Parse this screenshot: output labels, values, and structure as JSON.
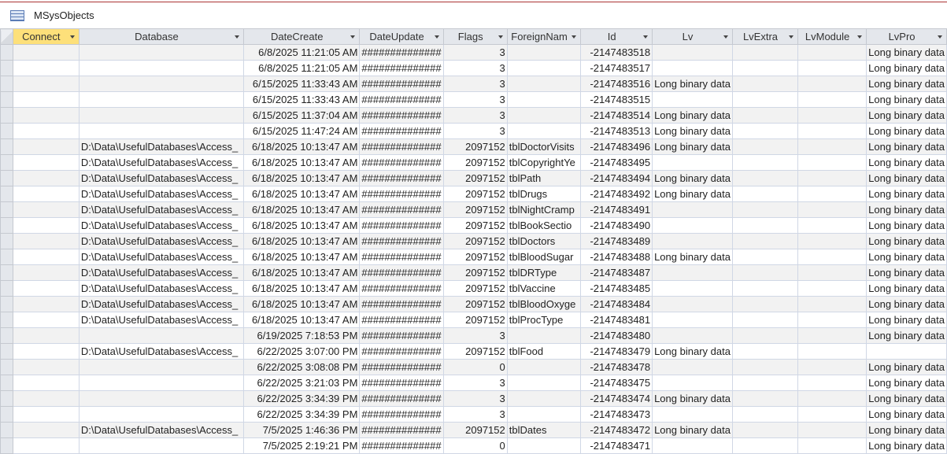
{
  "window": {
    "title": "MSysObjects",
    "icon": "table-icon"
  },
  "columns": [
    "Connect",
    "Database",
    "DateCreate",
    "DateUpdate",
    "Flags",
    "ForeignNam",
    "Id",
    "Lv",
    "LvExtra",
    "LvModule",
    "LvPro"
  ],
  "rows": [
    [
      "",
      "",
      "6/8/2025 11:21:05 AM",
      "##############",
      "3",
      "",
      "-2147483518",
      "",
      "",
      "",
      "Long binary data"
    ],
    [
      "",
      "",
      "6/8/2025 11:21:05 AM",
      "##############",
      "3",
      "",
      "-2147483517",
      "",
      "",
      "",
      "Long binary data"
    ],
    [
      "",
      "",
      "6/15/2025 11:33:43 AM",
      "##############",
      "3",
      "",
      "-2147483516",
      "Long binary data",
      "",
      "",
      "Long binary data"
    ],
    [
      "",
      "",
      "6/15/2025 11:33:43 AM",
      "##############",
      "3",
      "",
      "-2147483515",
      "",
      "",
      "",
      "Long binary data"
    ],
    [
      "",
      "",
      "6/15/2025 11:37:04 AM",
      "##############",
      "3",
      "",
      "-2147483514",
      "Long binary data",
      "",
      "",
      "Long binary data"
    ],
    [
      "",
      "",
      "6/15/2025 11:47:24 AM",
      "##############",
      "3",
      "",
      "-2147483513",
      "Long binary data",
      "",
      "",
      "Long binary data"
    ],
    [
      "",
      "D:\\Data\\UsefulDatabases\\Access_",
      "6/18/2025 10:13:47 AM",
      "##############",
      "2097152",
      "tblDoctorVisits",
      "-2147483496",
      "Long binary data",
      "",
      "",
      "Long binary data"
    ],
    [
      "",
      "D:\\Data\\UsefulDatabases\\Access_",
      "6/18/2025 10:13:47 AM",
      "##############",
      "2097152",
      "tblCopyrightYe",
      "-2147483495",
      "",
      "",
      "",
      "Long binary data"
    ],
    [
      "",
      "D:\\Data\\UsefulDatabases\\Access_",
      "6/18/2025 10:13:47 AM",
      "##############",
      "2097152",
      "tblPath",
      "-2147483494",
      "Long binary data",
      "",
      "",
      "Long binary data"
    ],
    [
      "",
      "D:\\Data\\UsefulDatabases\\Access_",
      "6/18/2025 10:13:47 AM",
      "##############",
      "2097152",
      "tblDrugs",
      "-2147483492",
      "Long binary data",
      "",
      "",
      "Long binary data"
    ],
    [
      "",
      "D:\\Data\\UsefulDatabases\\Access_",
      "6/18/2025 10:13:47 AM",
      "##############",
      "2097152",
      "tblNightCramp",
      "-2147483491",
      "",
      "",
      "",
      "Long binary data"
    ],
    [
      "",
      "D:\\Data\\UsefulDatabases\\Access_",
      "6/18/2025 10:13:47 AM",
      "##############",
      "2097152",
      "tblBookSectio",
      "-2147483490",
      "",
      "",
      "",
      "Long binary data"
    ],
    [
      "",
      "D:\\Data\\UsefulDatabases\\Access_",
      "6/18/2025 10:13:47 AM",
      "##############",
      "2097152",
      "tblDoctors",
      "-2147483489",
      "",
      "",
      "",
      "Long binary data"
    ],
    [
      "",
      "D:\\Data\\UsefulDatabases\\Access_",
      "6/18/2025 10:13:47 AM",
      "##############",
      "2097152",
      "tblBloodSugar",
      "-2147483488",
      "Long binary data",
      "",
      "",
      "Long binary data"
    ],
    [
      "",
      "D:\\Data\\UsefulDatabases\\Access_",
      "6/18/2025 10:13:47 AM",
      "##############",
      "2097152",
      "tblDRType",
      "-2147483487",
      "",
      "",
      "",
      "Long binary data"
    ],
    [
      "",
      "D:\\Data\\UsefulDatabases\\Access_",
      "6/18/2025 10:13:47 AM",
      "##############",
      "2097152",
      "tblVaccine",
      "-2147483485",
      "",
      "",
      "",
      "Long binary data"
    ],
    [
      "",
      "D:\\Data\\UsefulDatabases\\Access_",
      "6/18/2025 10:13:47 AM",
      "##############",
      "2097152",
      "tblBloodOxyge",
      "-2147483484",
      "",
      "",
      "",
      "Long binary data"
    ],
    [
      "",
      "D:\\Data\\UsefulDatabases\\Access_",
      "6/18/2025 10:13:47 AM",
      "##############",
      "2097152",
      "tblProcType",
      "-2147483481",
      "",
      "",
      "",
      "Long binary data"
    ],
    [
      "",
      "",
      "6/19/2025 7:18:53 PM",
      "##############",
      "3",
      "",
      "-2147483480",
      "",
      "",
      "",
      "Long binary data"
    ],
    [
      "",
      "D:\\Data\\UsefulDatabases\\Access_",
      "6/22/2025 3:07:00 PM",
      "##############",
      "2097152",
      "tblFood",
      "-2147483479",
      "Long binary data",
      "",
      "",
      ""
    ],
    [
      "",
      "",
      "6/22/2025 3:08:08 PM",
      "##############",
      "0",
      "",
      "-2147483478",
      "",
      "",
      "",
      "Long binary data"
    ],
    [
      "",
      "",
      "6/22/2025 3:21:03 PM",
      "##############",
      "3",
      "",
      "-2147483475",
      "",
      "",
      "",
      "Long binary data"
    ],
    [
      "",
      "",
      "6/22/2025 3:34:39 PM",
      "##############",
      "3",
      "",
      "-2147483474",
      "Long binary data",
      "",
      "",
      "Long binary data"
    ],
    [
      "",
      "",
      "6/22/2025 3:34:39 PM",
      "##############",
      "3",
      "",
      "-2147483473",
      "",
      "",
      "",
      "Long binary data"
    ],
    [
      "",
      "D:\\Data\\UsefulDatabases\\Access_",
      "7/5/2025 1:46:36 PM",
      "##############",
      "2097152",
      "tblDates",
      "-2147483472",
      "Long binary data",
      "",
      "",
      "Long binary data"
    ],
    [
      "",
      "",
      "7/5/2025 2:19:21 PM",
      "##############",
      "0",
      "",
      "-2147483471",
      "",
      "",
      "",
      "Long binary data"
    ]
  ]
}
